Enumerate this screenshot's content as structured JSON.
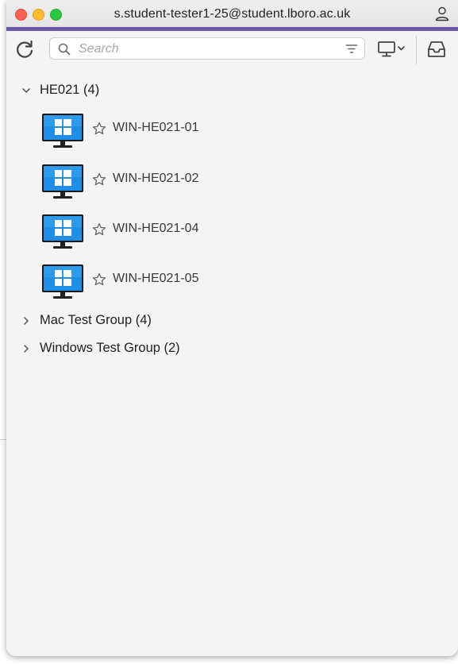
{
  "window": {
    "title": "s.student-tester1-25@student.lboro.ac.uk"
  },
  "toolbar": {
    "refresh_icon": "refresh-icon",
    "search_placeholder": "Search",
    "search_value": "",
    "filter_icon": "filter-icon",
    "display_icon": "monitor-dropdown-icon",
    "inbox_icon": "inbox-icon"
  },
  "groups": [
    {
      "label": "HE021 (4)",
      "expanded": true,
      "hosts": [
        {
          "name": "WIN-HE021-01"
        },
        {
          "name": "WIN-HE021-02"
        },
        {
          "name": "WIN-HE021-04"
        },
        {
          "name": "WIN-HE021-05"
        }
      ]
    },
    {
      "label": "Mac Test Group (4)",
      "expanded": false
    },
    {
      "label": "Windows Test Group (2)",
      "expanded": false
    }
  ],
  "colors": {
    "accent_bar": "#6b5aa8",
    "close": "#fe5f57",
    "minimize": "#febc2e",
    "zoom": "#28c840",
    "monitor_screen": "#1e8ee6"
  }
}
